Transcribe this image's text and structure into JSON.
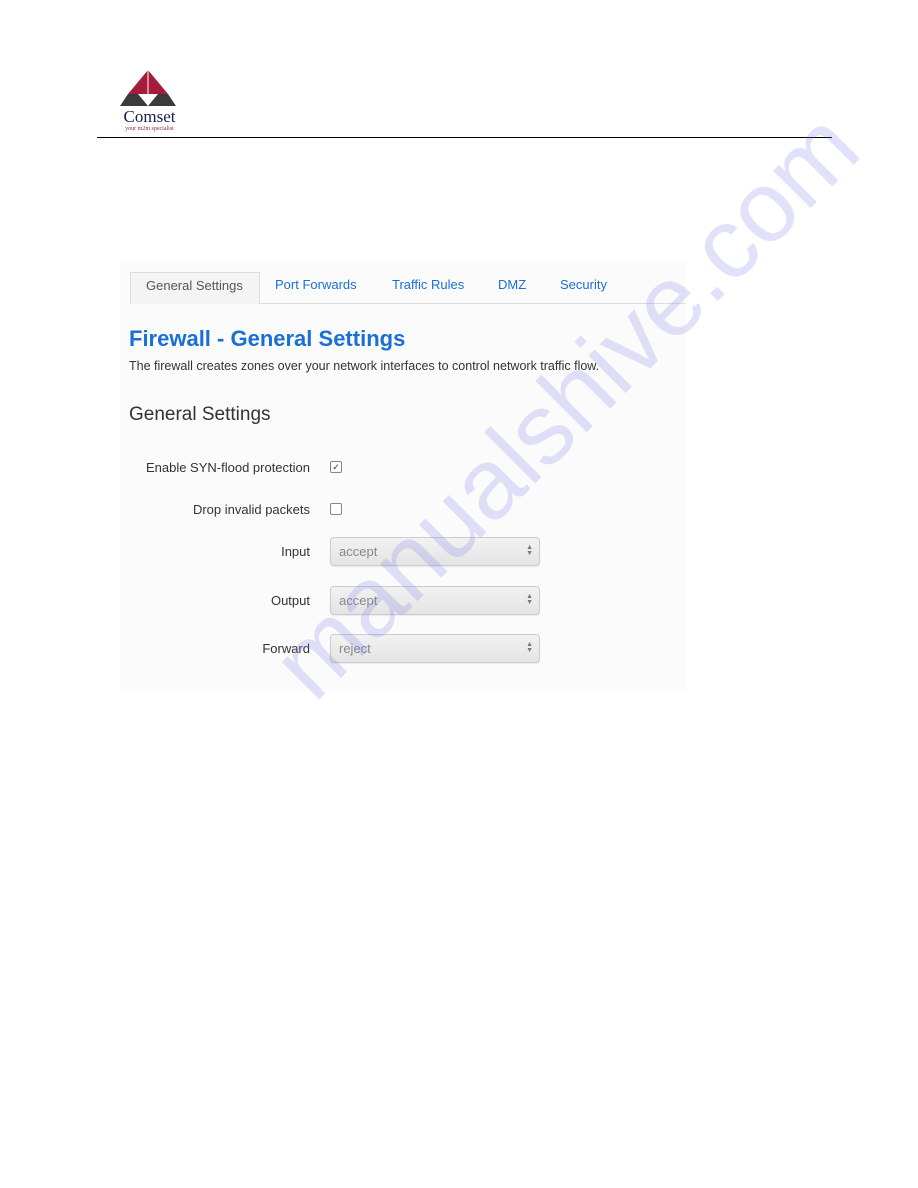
{
  "header": {
    "logo_brand": "Comset",
    "logo_tagline": "your m2m specialist"
  },
  "tabs": [
    {
      "label": "General Settings",
      "active": true
    },
    {
      "label": "Port Forwards"
    },
    {
      "label": "Traffic Rules"
    },
    {
      "label": "DMZ"
    },
    {
      "label": "Security"
    }
  ],
  "page": {
    "title": "Firewall - General Settings",
    "description": "The firewall creates zones over your network interfaces to control network traffic flow.",
    "section_title": "General Settings"
  },
  "fields": {
    "syn_flood": {
      "label": "Enable SYN-flood protection",
      "checked": true,
      "mark": "✓"
    },
    "drop_invalid": {
      "label": "Drop invalid packets",
      "checked": false
    },
    "input": {
      "label": "Input",
      "value": "accept"
    },
    "output": {
      "label": "Output",
      "value": "accept"
    },
    "forward": {
      "label": "Forward",
      "value": "reject"
    }
  },
  "watermark": "manualshive.com",
  "colors": {
    "accent": "#1a6fd6",
    "logo_red": "#a51d3b",
    "logo_dark": "#3b3b3b"
  }
}
